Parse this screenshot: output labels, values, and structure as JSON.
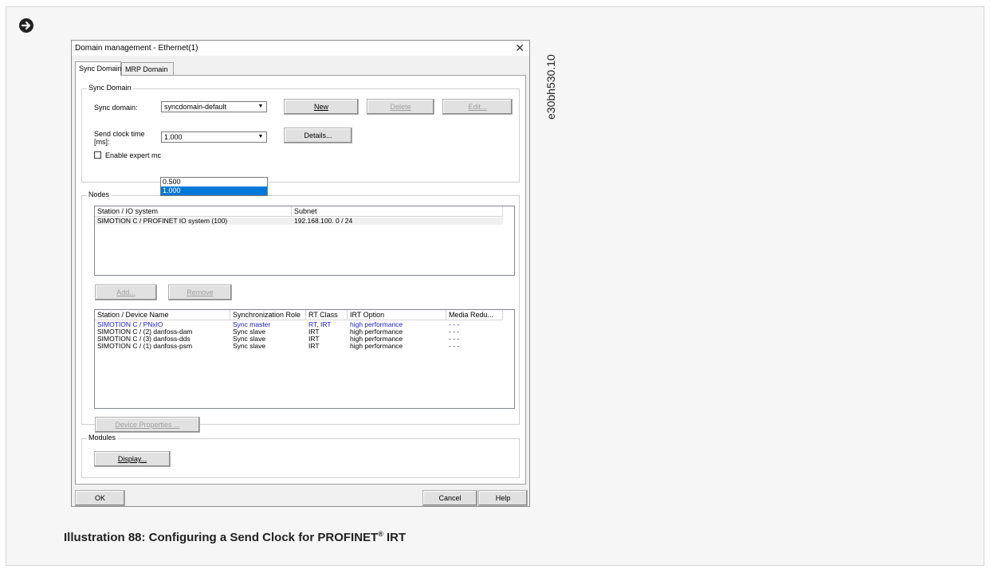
{
  "dialog": {
    "title": "Domain management - Ethernet(1)",
    "close": "✕",
    "tabs": [
      "Sync Domain",
      "MRP Domain"
    ],
    "sync_group": {
      "legend": "Sync Domain",
      "sync_domain_label": "Sync domain:",
      "sync_domain_value": "syncdomain-default",
      "new_button": "New",
      "delete_button": "Delete",
      "edit_button": "Edit...",
      "send_clock_label_1": "Send clock time",
      "send_clock_label_2": "[ms]:",
      "send_clock_value": "1.000",
      "details_button": "Details...",
      "dropdown_options": [
        "0.500",
        "1.000"
      ],
      "dropdown_selected": "1.000",
      "expert_mode_label": "Enable expert mc"
    },
    "nodes_group": {
      "legend": "Nodes",
      "columns": [
        "Station / IO system",
        "Subnet"
      ],
      "rows": [
        {
          "station": "SIMOTION C / PROFINET IO system (100)",
          "subnet": "192.168.100. 0 / 24"
        }
      ],
      "add_button": "Add...",
      "remove_button": "Remove",
      "device_columns": [
        "Station / Device Name",
        "Synchronization Role",
        "RT Class",
        "IRT Option",
        "Media Redu..."
      ],
      "devices": [
        {
          "name": "SIMOTION C / PNxIO",
          "role": "Sync master",
          "rt": "RT, IRT",
          "irt": "high performance",
          "media": "- - -",
          "highlight": true
        },
        {
          "name": "SIMOTION C / (2) danfoss-dam",
          "role": "Sync slave",
          "rt": "IRT",
          "irt": "high performance",
          "media": "- - -",
          "highlight": false
        },
        {
          "name": "SIMOTION C / (3) danfoss-dds",
          "role": "Sync slave",
          "rt": "IRT",
          "irt": "high performance",
          "media": "- - -",
          "highlight": false
        },
        {
          "name": "SIMOTION C / (1) danfoss-psm",
          "role": "Sync slave",
          "rt": "IRT",
          "irt": "high performance",
          "media": "- - -",
          "highlight": false
        }
      ],
      "device_properties_button": "Device Properties ..."
    },
    "modules_group": {
      "legend": "Modules",
      "display_button": "Display..."
    },
    "ok_button": "OK",
    "cancel_button": "Cancel",
    "help_button": "Help"
  },
  "side_label": "e30bh530.10",
  "caption": {
    "prefix": "Illustration 88: Configuring a Send Clock for PROFINET",
    "mark": "®",
    "suffix": " IRT"
  },
  "colors": {
    "selection": "#0078d7",
    "master_row_text": "#1a1acd"
  },
  "icons": {
    "arrow": "arrow-right-circle-icon"
  }
}
